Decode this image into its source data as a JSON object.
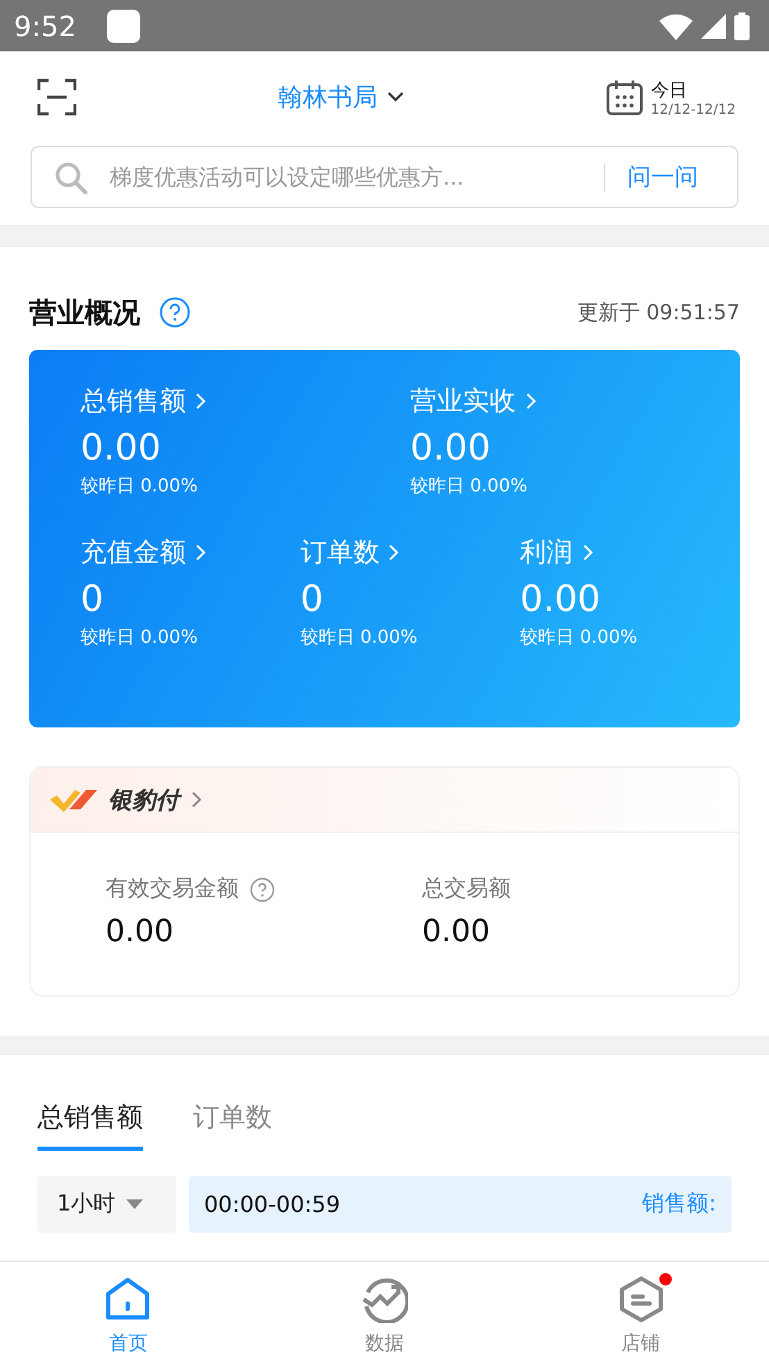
{
  "status_bar": {
    "time": "9:52"
  },
  "header": {
    "store": "翰林书局",
    "date_label": "今日",
    "date_range": "12/12-12/12"
  },
  "search": {
    "placeholder": "梯度优惠活动可以设定哪些优惠方...",
    "button": "问一问"
  },
  "overview": {
    "title": "营业概况",
    "updated": "更新于 09:51:57",
    "metric_rows": [
      [
        {
          "label": "总销售额",
          "value": "0.00",
          "compare": "较昨日 0.00%"
        },
        {
          "label": "营业实收",
          "value": "0.00",
          "compare": "较昨日 0.00%"
        }
      ],
      [
        {
          "label": "充值金额",
          "value": "0",
          "compare": "较昨日 0.00%"
        },
        {
          "label": "订单数",
          "value": "0",
          "compare": "较昨日 0.00%"
        },
        {
          "label": "利润",
          "value": "0.00",
          "compare": "较昨日 0.00%"
        }
      ]
    ]
  },
  "pay": {
    "brand": "银豹付",
    "items": [
      {
        "label": "有效交易金额",
        "value": "0.00",
        "kind": "help"
      },
      {
        "label": "总交易额",
        "value": "0.00",
        "kind": "plain"
      }
    ]
  },
  "sales": {
    "tabs": [
      {
        "label": "总销售额",
        "selected": true
      },
      {
        "label": "订单数",
        "selected": false
      }
    ],
    "period": "1小时",
    "time_range": "00:00-00:59",
    "amount_label": "销售额:"
  },
  "nav": [
    {
      "label": "首页",
      "kind": "home",
      "selected": true,
      "badge": false
    },
    {
      "label": "数据",
      "kind": "chart",
      "selected": false,
      "badge": false
    },
    {
      "label": "店铺",
      "kind": "store",
      "selected": false,
      "badge": true
    }
  ]
}
